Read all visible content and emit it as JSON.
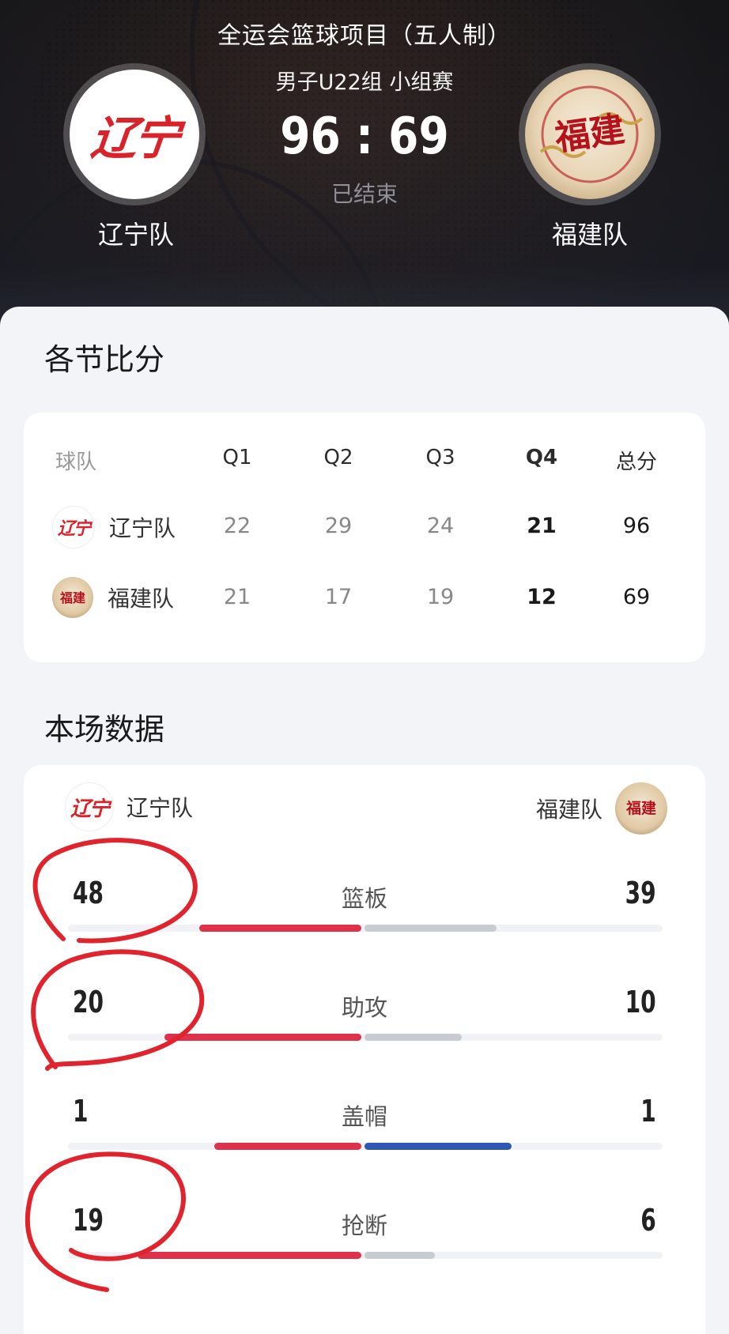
{
  "match": {
    "competition": "全运会篮球项目（五人制）",
    "stage": "男子U22组 小组赛",
    "score": "96 : 69",
    "status": "已结束"
  },
  "home": {
    "name": "辽宁队",
    "logo_text": "辽宁"
  },
  "away": {
    "name": "福建队",
    "logo_text": "福建"
  },
  "quarters": {
    "title": "各节比分",
    "headers": [
      "球队",
      "Q1",
      "Q2",
      "Q3",
      "Q4",
      "总分"
    ],
    "rows": [
      {
        "team": "辽宁队",
        "q1": "22",
        "q2": "29",
        "q3": "24",
        "q4": "21",
        "total": "96"
      },
      {
        "team": "福建队",
        "q1": "21",
        "q2": "17",
        "q3": "19",
        "q4": "12",
        "total": "69"
      }
    ]
  },
  "stats": {
    "title": "本场数据",
    "home_team": "辽宁队",
    "away_team": "福建队",
    "items": [
      {
        "label": "篮板",
        "home": "48",
        "away": "39",
        "home_share": 0.55,
        "away_share": 0.45
      },
      {
        "label": "助攻",
        "home": "20",
        "away": "10",
        "home_share": 0.67,
        "away_share": 0.33
      },
      {
        "label": "盖帽",
        "home": "1",
        "away": "1",
        "home_share": 0.5,
        "away_share": 0.5
      },
      {
        "label": "抢断",
        "home": "19",
        "away": "6",
        "home_share": 0.76,
        "away_share": 0.24
      }
    ]
  },
  "colors": {
    "home_bar": "#e0314a",
    "away_bar_grey": "#c8cbd2",
    "away_bar_blue": "#2f56b5",
    "annotation": "#e0232c"
  }
}
